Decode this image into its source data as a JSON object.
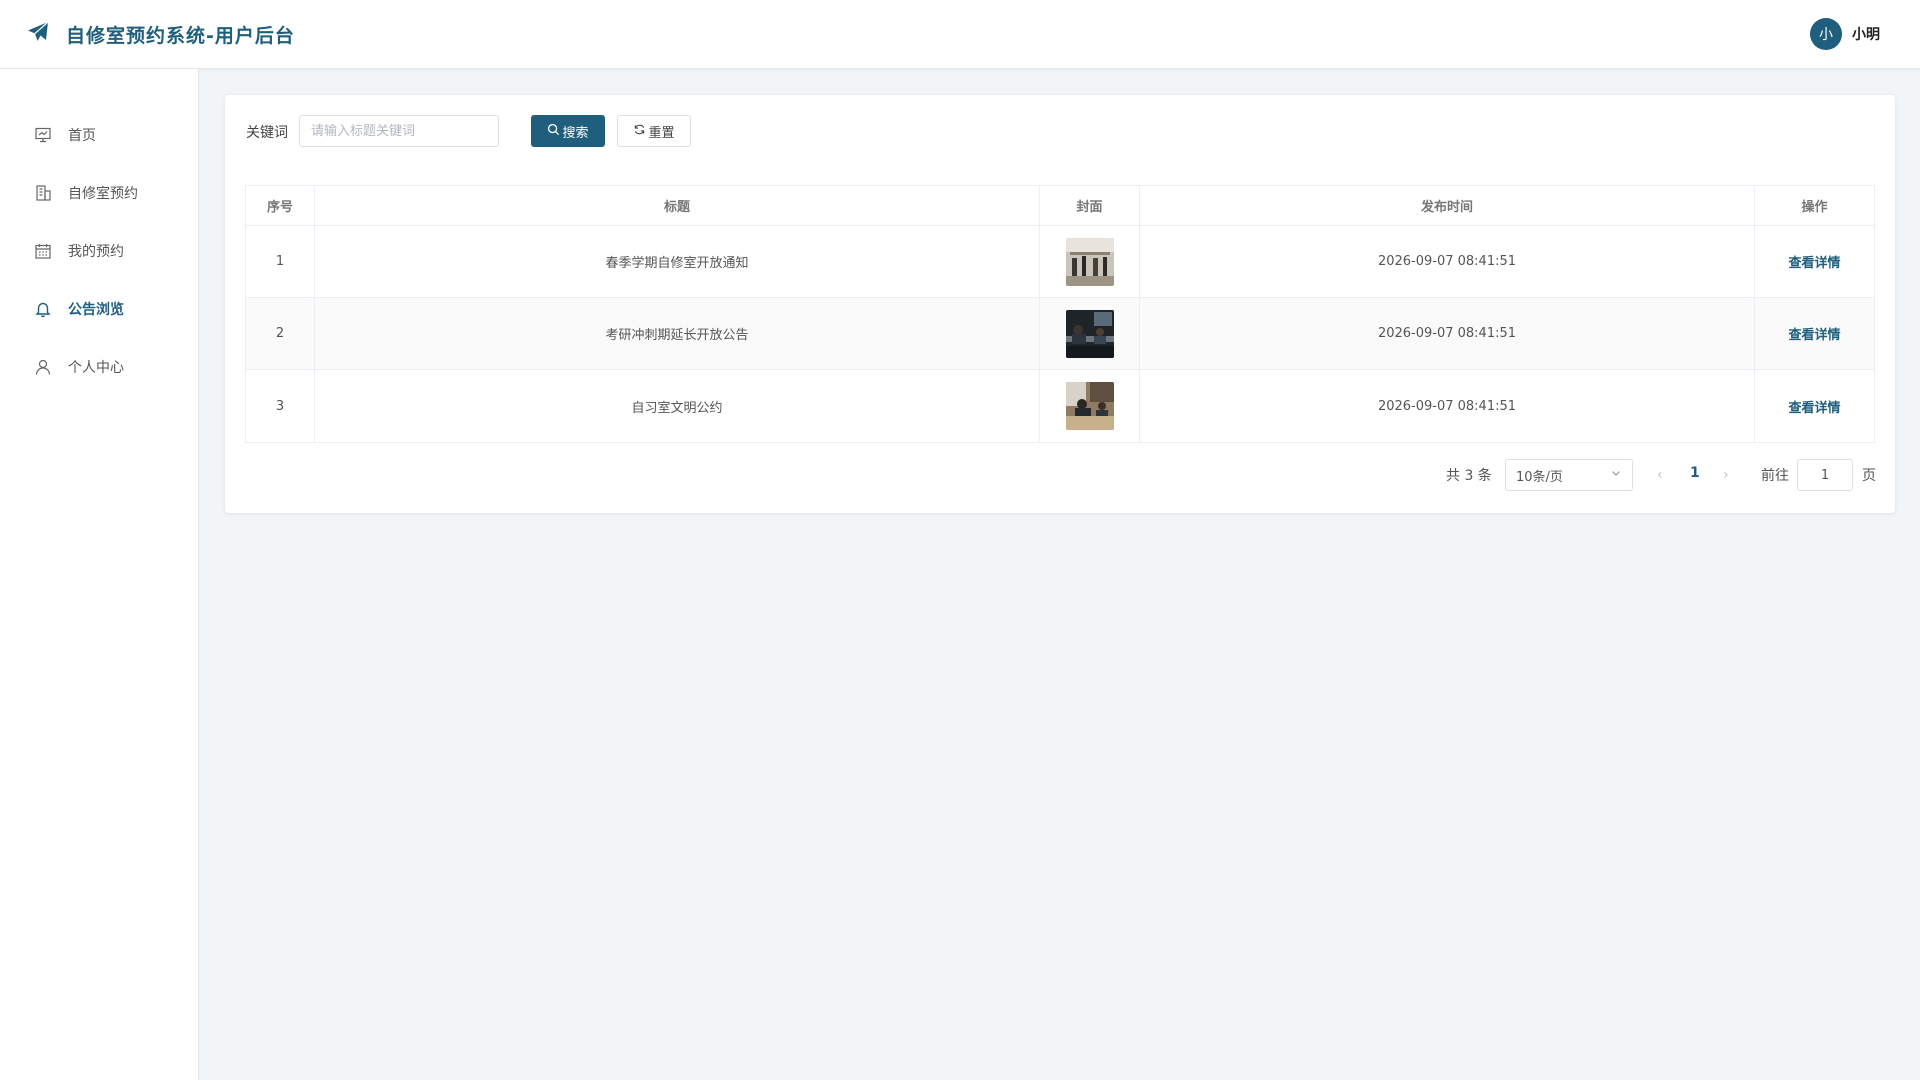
{
  "header": {
    "title": "自修室预约系统-用户后台",
    "logo_icon": "paper-plane-icon",
    "user": {
      "avatar_text": "小",
      "name": "小明"
    }
  },
  "sidebar": {
    "items": [
      {
        "label": "首页",
        "icon": "presentation-icon",
        "active": false
      },
      {
        "label": "自修室预约",
        "icon": "building-icon",
        "active": false
      },
      {
        "label": "我的预约",
        "icon": "calendar-icon",
        "active": false
      },
      {
        "label": "公告浏览",
        "icon": "bell-icon",
        "active": true
      },
      {
        "label": "个人中心",
        "icon": "user-icon",
        "active": false
      }
    ]
  },
  "search": {
    "label": "关键词",
    "placeholder": "请输入标题关键词",
    "value": "",
    "search_label": "搜索",
    "reset_label": "重置"
  },
  "table": {
    "columns": [
      "序号",
      "标题",
      "封面",
      "发布时间",
      "操作"
    ],
    "rows": [
      {
        "index": "1",
        "title": "春季学期自修室开放通知",
        "cover": "library-hall-photo",
        "time": "2026-09-07 08:41:51",
        "action": "查看详情"
      },
      {
        "index": "2",
        "title": "考研冲刺期延长开放公告",
        "cover": "study-room-photo",
        "time": "2026-09-07 08:41:51",
        "action": "查看详情"
      },
      {
        "index": "3",
        "title": "自习室文明公约",
        "cover": "reading-desk-photo",
        "time": "2026-09-07 08:41:51",
        "action": "查看详情"
      }
    ]
  },
  "pagination": {
    "total_text": "共 3 条",
    "page_size": "10条/页",
    "current_page": "1",
    "goto_label": "前往",
    "goto_value": "1",
    "goto_suffix": "页"
  },
  "colors": {
    "primary": "#1f5f7d",
    "background": "#f2f5f8"
  }
}
